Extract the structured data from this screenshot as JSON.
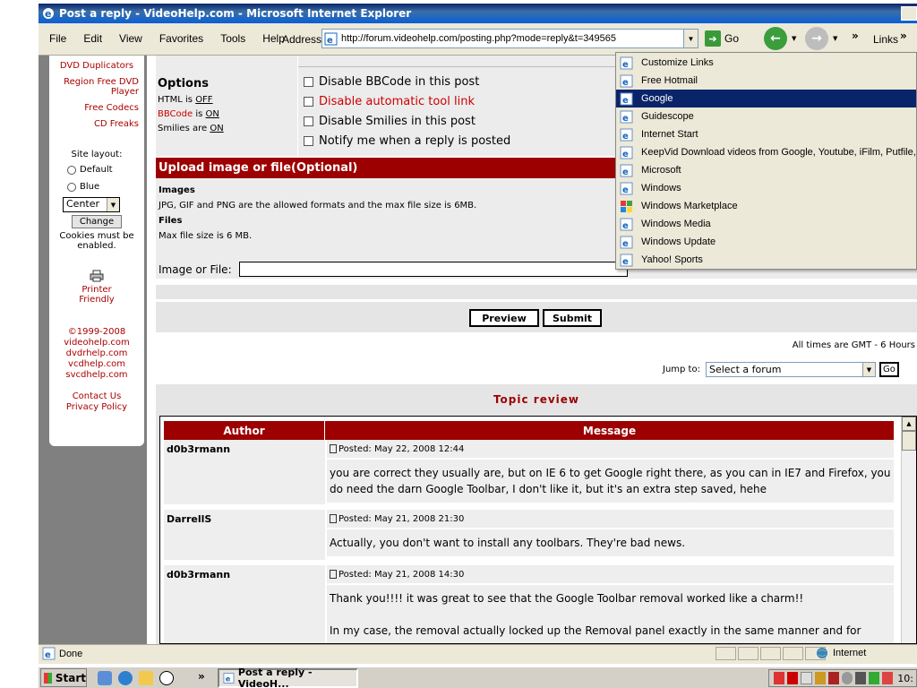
{
  "window": {
    "title": "Post a reply - VideoHelp.com - Microsoft Internet Explorer"
  },
  "menu": [
    "File",
    "Edit",
    "View",
    "Favorites",
    "Tools",
    "Help"
  ],
  "address": {
    "label": "Address",
    "url": "http://forum.videohelp.com/posting.php?mode=reply&t=349565",
    "go_label": "Go"
  },
  "links_label": "Links",
  "links_menu": {
    "items": [
      "Customize Links",
      "Free Hotmail",
      "Google",
      "Guidescope",
      "Internet Start",
      "KeepVid Download videos from Google, Youtube, iFilm, Putfile, M",
      "Microsoft",
      "Windows",
      "Windows Marketplace",
      "Windows Media",
      "Windows Update",
      "Yahoo! Sports"
    ],
    "selected": "Google"
  },
  "sidebar": {
    "links": [
      "DVD Duplicators",
      "Region Free DVD Player",
      "Free Codecs",
      "CD Freaks"
    ],
    "site_layout_label": "Site layout:",
    "layout_options": [
      "Default",
      "Blue"
    ],
    "align_value": "Center",
    "change_label": "Change",
    "cookies_note": "Cookies must be enabled.",
    "printer_label": "Printer Friendly",
    "copyright": "©1999-2008",
    "sites": [
      "videohelp.com",
      "dvdrhelp.com",
      "vcdhelp.com",
      "svcdhelp.com"
    ],
    "contact": "Contact Us",
    "privacy": "Privacy Policy"
  },
  "options": {
    "title": "Options",
    "html_label": "HTML is",
    "html_value": "OFF",
    "bbcode_label": "BBCode",
    "bbcode_is": "is",
    "bbcode_value": "ON",
    "smilies_label": "Smilies are",
    "smilies_value": "ON",
    "checkboxes": [
      "Disable BBCode in this post",
      "Disable automatic tool link",
      "Disable Smilies in this post",
      "Notify me when a reply is posted"
    ]
  },
  "upload": {
    "title": "Upload image or file(Optional)",
    "images_heading": "Images",
    "images_text": "JPG, GIF and PNG are the allowed formats and the max file size is 6MB.",
    "files_heading": "Files",
    "files_text": "Max file size is 6 MB.",
    "file_label": "Image or File:"
  },
  "buttons": {
    "preview": "Preview",
    "submit": "Submit"
  },
  "times_note": "All times are GMT - 6 Hours",
  "jump": {
    "label": "Jump to:",
    "value": "Select a forum",
    "go": "Go"
  },
  "review": {
    "title": "Topic review",
    "col_author": "Author",
    "col_message": "Message",
    "posts": [
      {
        "author": "d0b3rmann",
        "posted": "Posted: May 22, 2008 12:44",
        "message": "you are correct they usually are, but on IE 6 to get Google right there, as you can in IE7 and Firefox, you do need the darn Google Toolbar, I don't like it, but it's an extra step saved, hehe"
      },
      {
        "author": "DarrellS",
        "posted": "Posted: May 21, 2008 21:30",
        "message": "Actually, you don't want to install any toolbars. They're bad news."
      },
      {
        "author": "d0b3rmann",
        "posted": "Posted: May 21, 2008 14:30",
        "message": "Thank you!!!! it was great to see that the Google Toolbar removal worked like a charm!!",
        "message2": "In my case, the removal actually locked up the Removal panel exactly in the same manner and for"
      }
    ]
  },
  "status": {
    "text": "Done",
    "zone": "Internet"
  },
  "taskbar": {
    "start": "Start",
    "task": "Post a reply - VideoH...",
    "clock": "10:"
  }
}
